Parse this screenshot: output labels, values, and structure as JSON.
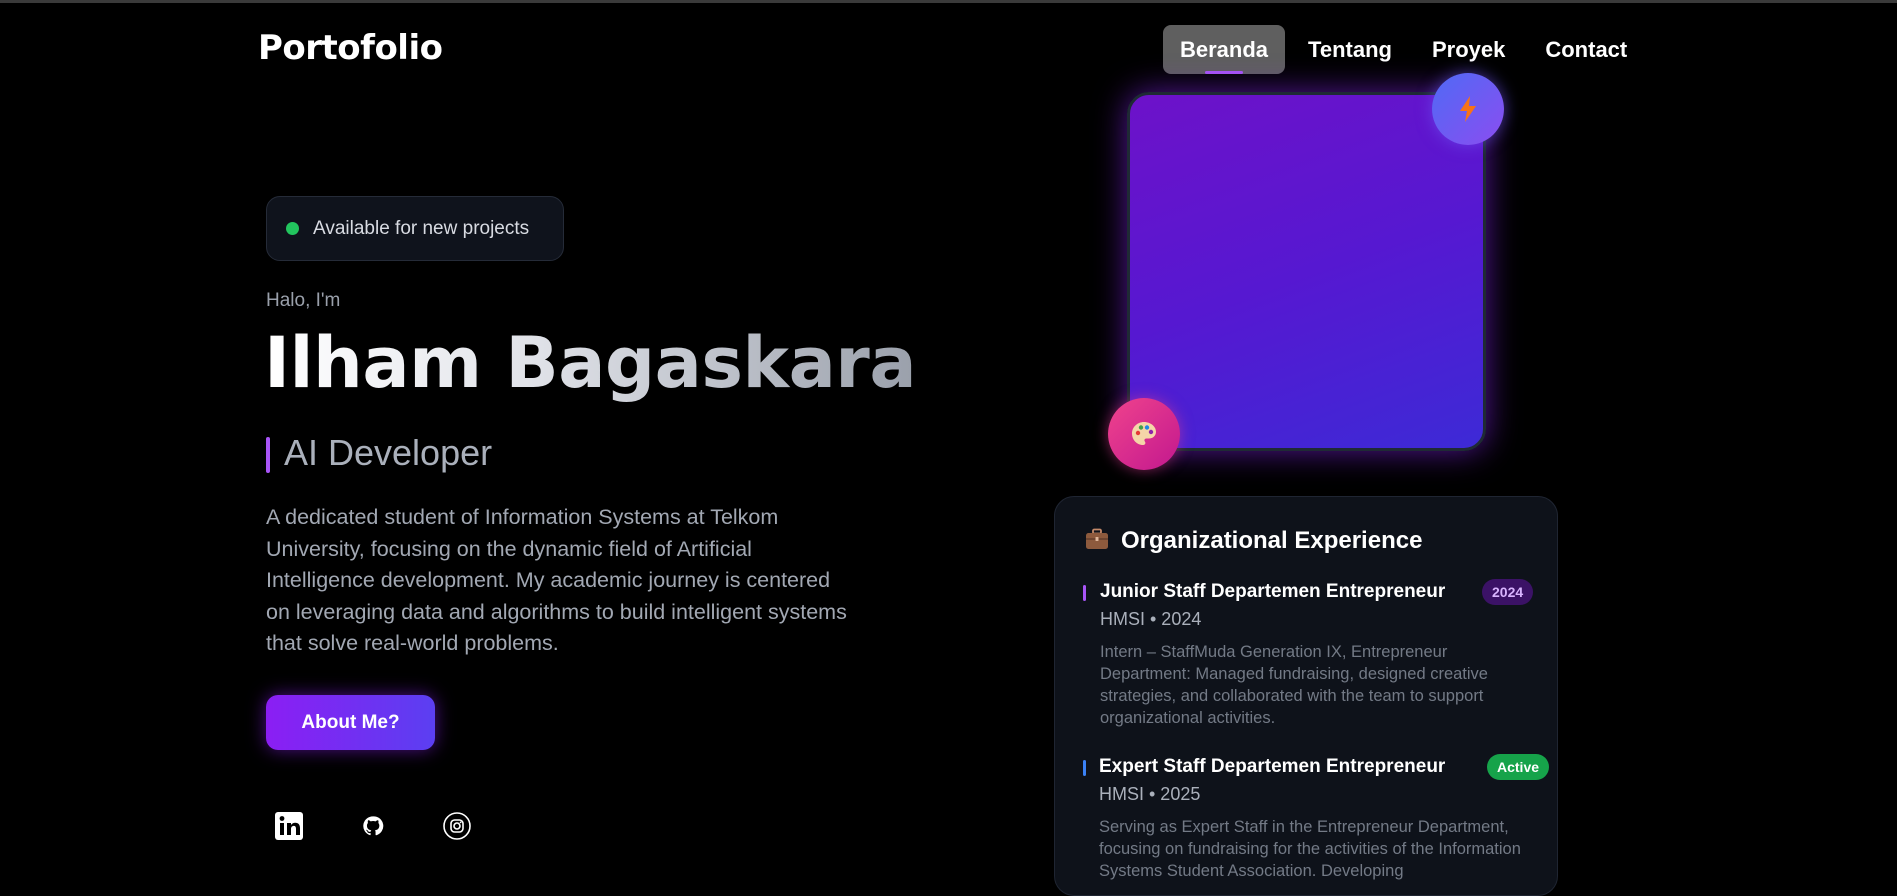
{
  "header": {
    "logo": "Portofolio",
    "nav": [
      {
        "label": "Beranda",
        "active": true
      },
      {
        "label": "Tentang",
        "active": false
      },
      {
        "label": "Proyek",
        "active": false
      },
      {
        "label": "Contact",
        "active": false
      }
    ]
  },
  "hero": {
    "badge": "Available for new projects",
    "greeting": "Halo, I'm",
    "name": "Ilham Bagaskara",
    "role": "AI Developer",
    "bio": "A dedicated student of Information Systems at Telkom University, focusing on the dynamic field of Artificial Intelligence development. My academic journey is centered on leveraging data and algorithms to build intelligent systems that solve real-world problems.",
    "cta": "About Me?",
    "socials": [
      {
        "icon": "linkedin-icon"
      },
      {
        "icon": "github-icon"
      },
      {
        "icon": "instagram-icon"
      }
    ]
  },
  "floating_icons": [
    "bolt-icon",
    "palette-icon"
  ],
  "experience": {
    "icon": "briefcase-icon",
    "title": "Organizational Experience",
    "items": [
      {
        "role": "Junior Staff Departemen Entrepreneur",
        "tag": "2024",
        "meta": "HMSI • 2024",
        "desc": "Intern – StaffMuda Generation IX, Entrepreneur Department: Managed fundraising, designed creative strategies, and collaborated with the team to support organizational activities."
      },
      {
        "role": "Expert Staff Departemen Entrepreneur",
        "tag": "Active",
        "meta": "HMSI • 2025",
        "desc": "Serving as Expert Staff in the Entrepreneur Department, focusing on fundraising for the activities of the Information Systems Student Association. Developing"
      }
    ]
  },
  "colors": {
    "accent_purple": "#a855f7",
    "status_green": "#22c55e",
    "tag_purple_bg": "#3b1266",
    "tag_green_bg": "#16a34a"
  }
}
